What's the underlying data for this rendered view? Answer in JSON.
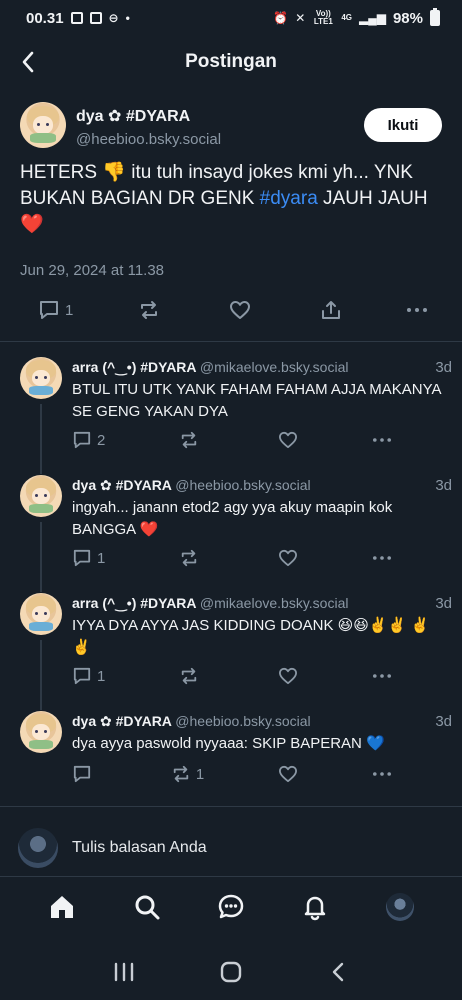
{
  "status_bar": {
    "time": "00.31",
    "network_label": "Vo)) LTE1",
    "network_type": "4G",
    "battery": "98%"
  },
  "header": {
    "title": "Postingan"
  },
  "main_post": {
    "author_name": "dya ✿ #DYARA",
    "author_handle": "@heebioo.bsky.social",
    "follow_label": "Ikuti",
    "text_before": "HETERS 👎 itu tuh insayd jokes kmi yh... YNK BUKAN BAGIAN DR GENK ",
    "hashtag": "#dyara",
    "text_after": " JAUH JAUH ❤️",
    "date": "Jun 29, 2024 at 11.38",
    "reply_count": "1",
    "repost_count": "",
    "like_count": ""
  },
  "replies": [
    {
      "name": "arra (^‿•) #DYARA",
      "handle": "@mikaelove.bsky.social",
      "time": "3d",
      "text": "BTUL ITU UTK YANK FAHAM FAHAM AJJA MAKANYA SE GENG YAKAN DYA",
      "reply_count": "2",
      "repost_count": ""
    },
    {
      "name": "dya ✿ #DYARA",
      "handle": "@heebioo.bsky.social",
      "time": "3d",
      "text": "ingyah... janann etod2 agy yya akuy maapin kok BANGGA ❤️",
      "reply_count": "1",
      "repost_count": ""
    },
    {
      "name": "arra (^‿•) #DYARA",
      "handle": "@mikaelove.bsky.social",
      "time": "3d",
      "text": "IYYA DYA AYYA JAS KIDDING DOANK 😆😆✌️✌️ ✌️✌️",
      "reply_count": "1",
      "repost_count": ""
    },
    {
      "name": "dya ✿ #DYARA",
      "handle": "@heebioo.bsky.social",
      "time": "3d",
      "text": "dya ayya paswold nyyaaa: SKIP BAPERAN 💙",
      "reply_count": "",
      "repost_count": "1"
    }
  ],
  "compose": {
    "placeholder": "Tulis balasan Anda"
  },
  "colors": {
    "background": "#161e27",
    "accent": "#3b8cf5",
    "muted": "#8b98a5",
    "divider": "#2e3945"
  }
}
